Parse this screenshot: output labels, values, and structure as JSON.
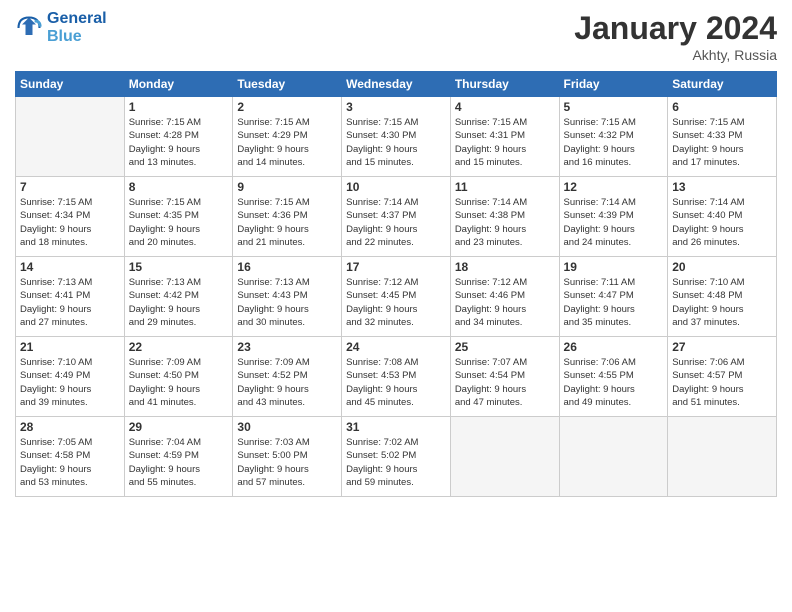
{
  "logo": {
    "line1": "General",
    "line2": "Blue"
  },
  "title": "January 2024",
  "location": "Akhty, Russia",
  "days_of_week": [
    "Sunday",
    "Monday",
    "Tuesday",
    "Wednesday",
    "Thursday",
    "Friday",
    "Saturday"
  ],
  "weeks": [
    [
      {
        "day": "",
        "info": ""
      },
      {
        "day": "1",
        "info": "Sunrise: 7:15 AM\nSunset: 4:28 PM\nDaylight: 9 hours\nand 13 minutes."
      },
      {
        "day": "2",
        "info": "Sunrise: 7:15 AM\nSunset: 4:29 PM\nDaylight: 9 hours\nand 14 minutes."
      },
      {
        "day": "3",
        "info": "Sunrise: 7:15 AM\nSunset: 4:30 PM\nDaylight: 9 hours\nand 15 minutes."
      },
      {
        "day": "4",
        "info": "Sunrise: 7:15 AM\nSunset: 4:31 PM\nDaylight: 9 hours\nand 15 minutes."
      },
      {
        "day": "5",
        "info": "Sunrise: 7:15 AM\nSunset: 4:32 PM\nDaylight: 9 hours\nand 16 minutes."
      },
      {
        "day": "6",
        "info": "Sunrise: 7:15 AM\nSunset: 4:33 PM\nDaylight: 9 hours\nand 17 minutes."
      }
    ],
    [
      {
        "day": "7",
        "info": "Sunrise: 7:15 AM\nSunset: 4:34 PM\nDaylight: 9 hours\nand 18 minutes."
      },
      {
        "day": "8",
        "info": "Sunrise: 7:15 AM\nSunset: 4:35 PM\nDaylight: 9 hours\nand 20 minutes."
      },
      {
        "day": "9",
        "info": "Sunrise: 7:15 AM\nSunset: 4:36 PM\nDaylight: 9 hours\nand 21 minutes."
      },
      {
        "day": "10",
        "info": "Sunrise: 7:14 AM\nSunset: 4:37 PM\nDaylight: 9 hours\nand 22 minutes."
      },
      {
        "day": "11",
        "info": "Sunrise: 7:14 AM\nSunset: 4:38 PM\nDaylight: 9 hours\nand 23 minutes."
      },
      {
        "day": "12",
        "info": "Sunrise: 7:14 AM\nSunset: 4:39 PM\nDaylight: 9 hours\nand 24 minutes."
      },
      {
        "day": "13",
        "info": "Sunrise: 7:14 AM\nSunset: 4:40 PM\nDaylight: 9 hours\nand 26 minutes."
      }
    ],
    [
      {
        "day": "14",
        "info": "Sunrise: 7:13 AM\nSunset: 4:41 PM\nDaylight: 9 hours\nand 27 minutes."
      },
      {
        "day": "15",
        "info": "Sunrise: 7:13 AM\nSunset: 4:42 PM\nDaylight: 9 hours\nand 29 minutes."
      },
      {
        "day": "16",
        "info": "Sunrise: 7:13 AM\nSunset: 4:43 PM\nDaylight: 9 hours\nand 30 minutes."
      },
      {
        "day": "17",
        "info": "Sunrise: 7:12 AM\nSunset: 4:45 PM\nDaylight: 9 hours\nand 32 minutes."
      },
      {
        "day": "18",
        "info": "Sunrise: 7:12 AM\nSunset: 4:46 PM\nDaylight: 9 hours\nand 34 minutes."
      },
      {
        "day": "19",
        "info": "Sunrise: 7:11 AM\nSunset: 4:47 PM\nDaylight: 9 hours\nand 35 minutes."
      },
      {
        "day": "20",
        "info": "Sunrise: 7:10 AM\nSunset: 4:48 PM\nDaylight: 9 hours\nand 37 minutes."
      }
    ],
    [
      {
        "day": "21",
        "info": "Sunrise: 7:10 AM\nSunset: 4:49 PM\nDaylight: 9 hours\nand 39 minutes."
      },
      {
        "day": "22",
        "info": "Sunrise: 7:09 AM\nSunset: 4:50 PM\nDaylight: 9 hours\nand 41 minutes."
      },
      {
        "day": "23",
        "info": "Sunrise: 7:09 AM\nSunset: 4:52 PM\nDaylight: 9 hours\nand 43 minutes."
      },
      {
        "day": "24",
        "info": "Sunrise: 7:08 AM\nSunset: 4:53 PM\nDaylight: 9 hours\nand 45 minutes."
      },
      {
        "day": "25",
        "info": "Sunrise: 7:07 AM\nSunset: 4:54 PM\nDaylight: 9 hours\nand 47 minutes."
      },
      {
        "day": "26",
        "info": "Sunrise: 7:06 AM\nSunset: 4:55 PM\nDaylight: 9 hours\nand 49 minutes."
      },
      {
        "day": "27",
        "info": "Sunrise: 7:06 AM\nSunset: 4:57 PM\nDaylight: 9 hours\nand 51 minutes."
      }
    ],
    [
      {
        "day": "28",
        "info": "Sunrise: 7:05 AM\nSunset: 4:58 PM\nDaylight: 9 hours\nand 53 minutes."
      },
      {
        "day": "29",
        "info": "Sunrise: 7:04 AM\nSunset: 4:59 PM\nDaylight: 9 hours\nand 55 minutes."
      },
      {
        "day": "30",
        "info": "Sunrise: 7:03 AM\nSunset: 5:00 PM\nDaylight: 9 hours\nand 57 minutes."
      },
      {
        "day": "31",
        "info": "Sunrise: 7:02 AM\nSunset: 5:02 PM\nDaylight: 9 hours\nand 59 minutes."
      },
      {
        "day": "",
        "info": ""
      },
      {
        "day": "",
        "info": ""
      },
      {
        "day": "",
        "info": ""
      }
    ]
  ]
}
